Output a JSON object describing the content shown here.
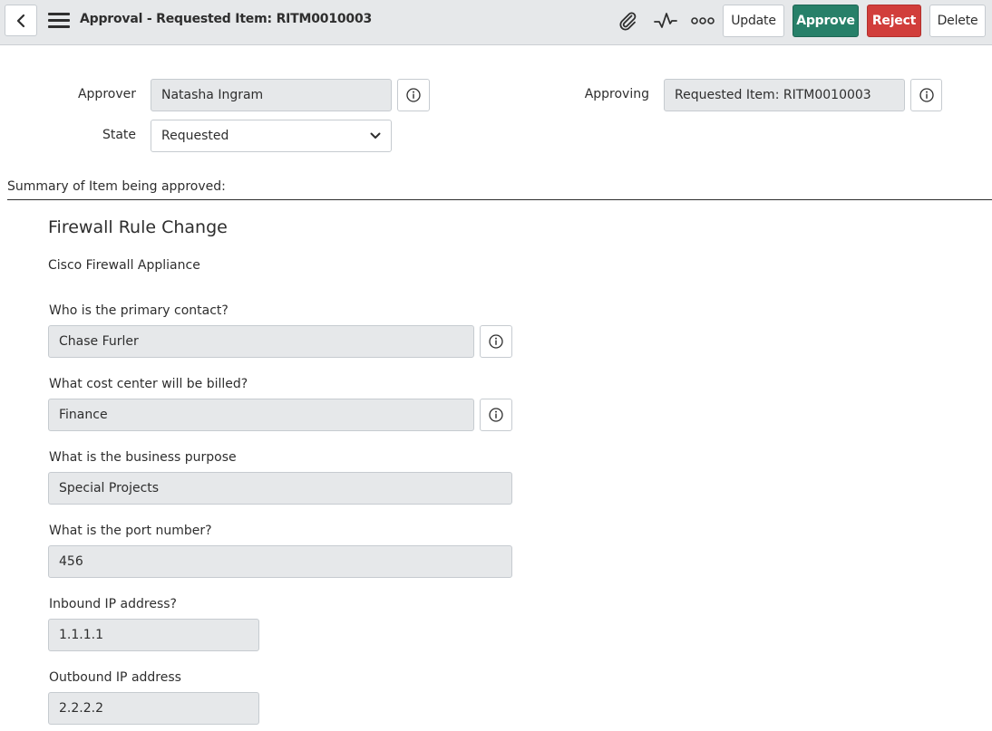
{
  "header": {
    "title": "Approval - Requested Item: RITM0010003",
    "icons": [
      "back-icon",
      "menu-icon",
      "paperclip-icon",
      "activity-icon",
      "more-icon"
    ],
    "buttons": {
      "update": "Update",
      "approve": "Approve",
      "reject": "Reject",
      "delete": "Delete"
    },
    "colors": {
      "approve": "#278069",
      "reject": "#d13e3b",
      "header_bg": "#e6e8ea"
    }
  },
  "form": {
    "approver_label": "Approver",
    "approver_value": "Natasha Ingram",
    "approving_label": "Approving",
    "approving_value": "Requested Item: RITM0010003",
    "state_label": "State",
    "state_value": "Requested"
  },
  "summary": {
    "label": "Summary of Item being approved:",
    "item_title": "Firewall Rule Change",
    "item_subtitle": "Cisco Firewall Appliance",
    "questions": [
      {
        "label": "Who is the primary contact?",
        "value": "Chase Furler"
      },
      {
        "label": "What cost center will be billed?",
        "value": "Finance"
      },
      {
        "label": "What is the business purpose",
        "value": "Special Projects"
      },
      {
        "label": "What is the port number?",
        "value": "456"
      },
      {
        "label": "Inbound IP address?",
        "value": "1.1.1.1"
      },
      {
        "label": "Outbound IP address",
        "value": "2.2.2.2"
      }
    ]
  }
}
